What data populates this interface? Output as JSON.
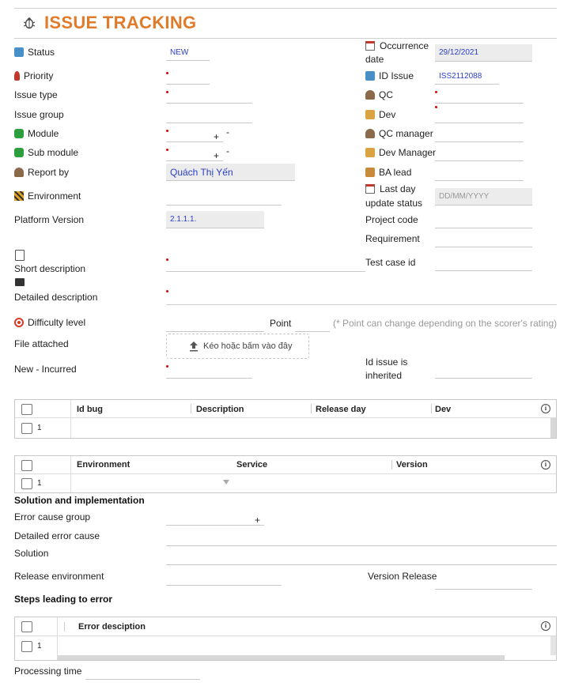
{
  "header": {
    "title": "ISSUE TRACKING"
  },
  "left": {
    "status": {
      "label": "Status",
      "value": "NEW"
    },
    "priority": {
      "label": "Priority"
    },
    "issue_type": {
      "label": "Issue type"
    },
    "issue_group": {
      "label": "Issue group"
    },
    "module": {
      "label": "Module"
    },
    "sub_module": {
      "label": "Sub module"
    },
    "report_by": {
      "label": "Report by",
      "value": "Quách Thị Yến"
    },
    "environment": {
      "label": "Environment"
    },
    "platform_version": {
      "label": "Platform Version",
      "value": "2.1.1.1."
    },
    "short_description": {
      "label": "Short description"
    },
    "detailed_description": {
      "label": "Detailed description"
    },
    "difficulty_level": {
      "label": "Difficulty level"
    },
    "point": {
      "label": "Point",
      "note": "(* Point can change depending on the scorer's rating)"
    },
    "file_attached": {
      "label": "File attached",
      "upload_text": "Kéo hoặc bấm vào đây"
    },
    "new_incurred": {
      "label": "New - Incurred"
    }
  },
  "right": {
    "occurrence_date": {
      "label_1": "Occurrence",
      "label_2": "date",
      "value": "29/12/2021"
    },
    "id_issue": {
      "label": "ID Issue",
      "value": "ISS2112088"
    },
    "qc": {
      "label": "QC"
    },
    "dev": {
      "label": "Dev"
    },
    "qc_manager": {
      "label": "QC manager"
    },
    "dev_manager": {
      "label": "Dev Manager"
    },
    "ba_lead": {
      "label": "BA lead"
    },
    "last_day_update": {
      "label_1": "Last day",
      "label_2": "update status",
      "placeholder": "DD/MM/YYYY"
    },
    "project_code": {
      "label": "Project code"
    },
    "requirement": {
      "label": "Requirement"
    },
    "test_case_id": {
      "label": "Test case id"
    },
    "id_issue_inherited": {
      "label_1": "Id issue is",
      "label_2": "inherited"
    }
  },
  "bug_table": {
    "columns": [
      "Id bug",
      "Description",
      "Release day",
      "Dev"
    ],
    "row_number": "1"
  },
  "env_table": {
    "columns": [
      "Environment",
      "Service",
      "Version"
    ],
    "row_number": "1"
  },
  "solution": {
    "section_title": "Solution and implementation",
    "error_cause_group": "Error cause group",
    "detailed_error_cause": "Detailed error cause",
    "solution": "Solution",
    "release_environment": "Release environment",
    "version_release": "Version Release"
  },
  "steps": {
    "section_title": "Steps leading to error",
    "columns": [
      "Error desciption"
    ],
    "row_number": "1"
  },
  "processing_time": {
    "label": "Processing time"
  },
  "colors": {
    "accent": "#e07b2a",
    "required": "#e00000",
    "link": "#2a3fc8"
  }
}
